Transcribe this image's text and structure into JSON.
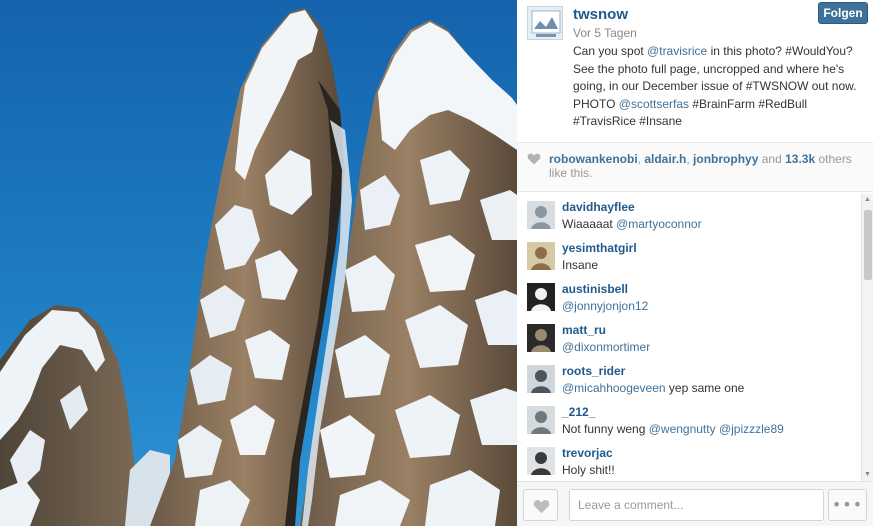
{
  "post": {
    "username": "twsnow",
    "timestamp": "Vor 5 Tagen",
    "follow_label": "Folgen",
    "caption_parts": [
      {
        "text": "Can you spot ",
        "link": false
      },
      {
        "text": "@travisrice",
        "link": true
      },
      {
        "text": " in this photo? #WouldYou? See the photo full page, uncropped and where he's going, in our December issue of #TWSNOW out now. PHOTO ",
        "link": false
      },
      {
        "text": "@scottserfas",
        "link": true
      },
      {
        "text": " #BrainFarm #RedBull #TravisRice #Insane",
        "link": false
      }
    ]
  },
  "likes": {
    "users": [
      "robowankenobi",
      "aldair.h",
      "jonbrophyy"
    ],
    "sep1": ", ",
    "sep2": ", ",
    "and_text": " and ",
    "count": "13.3k",
    "suffix": " others like this."
  },
  "comments": [
    {
      "user": "davidhayflee",
      "parts": [
        {
          "text": "Wiaaaaat ",
          "link": false
        },
        {
          "text": "@martyoconnor",
          "link": true
        }
      ]
    },
    {
      "user": "yesimthatgirl",
      "parts": [
        {
          "text": "Insane",
          "link": false
        }
      ]
    },
    {
      "user": "austinisbell",
      "parts": [
        {
          "text": "@jonnyjonjon12",
          "link": true
        }
      ]
    },
    {
      "user": "matt_ru",
      "parts": [
        {
          "text": "@dixonmortimer",
          "link": true
        }
      ]
    },
    {
      "user": "roots_rider",
      "parts": [
        {
          "text": "@micahhoogeveen",
          "link": true
        },
        {
          "text": " yep same one",
          "link": false
        }
      ]
    },
    {
      "user": "_212_",
      "parts": [
        {
          "text": "Not funny weng ",
          "link": false
        },
        {
          "text": "@wengnutty",
          "link": true
        },
        {
          "text": " ",
          "link": false
        },
        {
          "text": "@jpizzzle89",
          "link": true
        }
      ]
    },
    {
      "user": "trevorjac",
      "parts": [
        {
          "text": "Holy shit!!",
          "link": false
        }
      ]
    }
  ],
  "footer": {
    "comment_placeholder": "Leave a comment...",
    "more_label": "•••"
  },
  "icons": {
    "heart": "heart-icon",
    "more": "more-options-icon"
  },
  "colors": {
    "link": "#3f729b",
    "username": "#1f5a8c",
    "follow_button": "#3f729b",
    "sky": "#1d6fb4"
  }
}
